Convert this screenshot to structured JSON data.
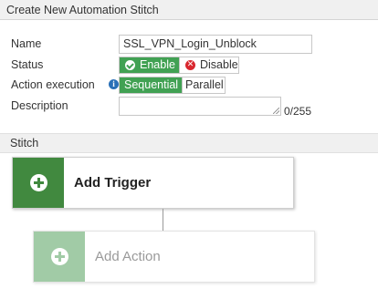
{
  "dialog": {
    "title": "Create New Automation Stitch"
  },
  "form": {
    "name_label": "Name",
    "name_value": "SSL_VPN_Login_Unblock",
    "status_label": "Status",
    "status_options": {
      "enable": "Enable",
      "disable": "Disable",
      "selected": "Enable"
    },
    "action_execution_label": "Action execution",
    "action_execution_options": {
      "sequential": "Sequential",
      "parallel": "Parallel",
      "selected": "Sequential"
    },
    "description_label": "Description",
    "description_value": "",
    "description_counter": "0/255"
  },
  "stitch": {
    "section_title": "Stitch",
    "add_trigger_label": "Add Trigger",
    "add_action_label": "Add Action"
  },
  "icons": {
    "info": "info-icon",
    "enable": "check-circle-icon",
    "disable": "x-circle-icon",
    "add": "plus-circle-icon"
  },
  "colors": {
    "active_toggle": "#41a153",
    "trigger_accent": "#41893f",
    "action_accent": "#a1cba6",
    "disable_icon": "#d9282f",
    "info_icon": "#2a70b7"
  }
}
